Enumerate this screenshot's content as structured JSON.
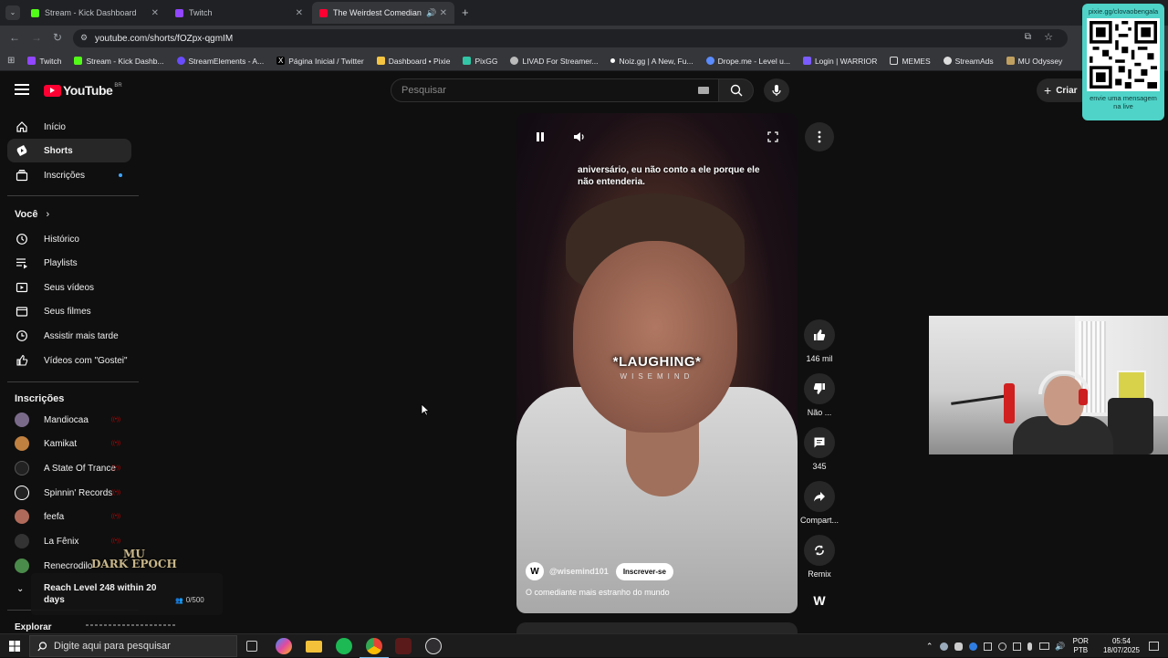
{
  "browser": {
    "tabs": [
      {
        "title": "Stream - Kick Dashboard",
        "color": "#53fc18"
      },
      {
        "title": "Twitch",
        "color": "#9146ff"
      },
      {
        "title": "The Weirdest Comedian in",
        "color": "#ff0033",
        "active": true
      }
    ],
    "url": "youtube.com/shorts/fOZpx-qgmIM",
    "bookmarks": [
      {
        "label": "Twitch",
        "color": "#9146ff"
      },
      {
        "label": "Stream - Kick Dashb...",
        "color": "#53fc18"
      },
      {
        "label": "StreamElements - A...",
        "color": "#6a4cff"
      },
      {
        "label": "Página Inicial / Twitter",
        "color": "#ffffff"
      },
      {
        "label": "Dashboard • Pixie",
        "color": "#f5c542"
      },
      {
        "label": "PixGG",
        "color": "#32c5a6"
      },
      {
        "label": "LIVAD For Streamer...",
        "color": "#bbbbbb"
      },
      {
        "label": "Noiz.gg | A New, Fu...",
        "color": "#ffffff"
      },
      {
        "label": "Drope.me - Level u...",
        "color": "#5b8cff"
      },
      {
        "label": "Login | WARRIOR",
        "color": "#7a5cff"
      },
      {
        "label": "MEMES",
        "color": "#dddddd"
      },
      {
        "label": "StreamAds",
        "color": "#dddddd"
      },
      {
        "label": "MU Odyssey",
        "color": "#c0a060"
      }
    ]
  },
  "youtube": {
    "logo": "YouTube",
    "region": "BR",
    "search_placeholder": "Pesquisar",
    "create_label": "Criar",
    "sidebar": {
      "main": [
        {
          "label": "Início",
          "icon": "home-icon"
        },
        {
          "label": "Shorts",
          "icon": "shorts-icon",
          "active": true
        },
        {
          "label": "Inscrições",
          "icon": "subscriptions-icon"
        }
      ],
      "you_heading": "Você",
      "you_items": [
        {
          "label": "Histórico",
          "icon": "history-icon"
        },
        {
          "label": "Playlists",
          "icon": "playlists-icon"
        },
        {
          "label": "Seus vídeos",
          "icon": "your-videos-icon"
        },
        {
          "label": "Seus filmes",
          "icon": "movies-icon"
        },
        {
          "label": "Assistir mais tarde",
          "icon": "watch-later-icon"
        },
        {
          "label": "Vídeos com \"Gostei\"",
          "icon": "liked-icon"
        }
      ],
      "subs_heading": "Inscrições",
      "subscriptions": [
        {
          "label": "Mandiocaa",
          "color": "#7a6a8a"
        },
        {
          "label": "Kamikat",
          "color": "#c08040"
        },
        {
          "label": "A State Of Trance",
          "color": "#222222"
        },
        {
          "label": "Spinnin' Records",
          "color": "#222222"
        },
        {
          "label": "feefa",
          "color": "#b06a5a"
        },
        {
          "label": "La Fênix",
          "color": "#333333"
        },
        {
          "label": "Renecrodilo",
          "color": "#4a8a4a"
        }
      ],
      "explore_heading": "Explorar"
    },
    "short": {
      "caption": "aniversário, eu não conto a ele porque ele não entenderia.",
      "overlay_text": "*LAUGHING*",
      "watermark": "WISEMIND",
      "channel": "@wisemind101",
      "channel_initial": "W",
      "subscribe_label": "Inscrever-se",
      "title": "O comediante mais estranho do mundo"
    },
    "actions": [
      {
        "label": "146 mil",
        "icon": "like-icon"
      },
      {
        "label": "Não ...",
        "icon": "dislike-icon"
      },
      {
        "label": "345",
        "icon": "comments-icon"
      },
      {
        "label": "Compart...",
        "icon": "share-icon"
      },
      {
        "label": "Remix",
        "icon": "remix-icon"
      }
    ],
    "channel_badge": "W"
  },
  "overlays": {
    "qr_top": "pixie.gg/clovaobengala",
    "qr_bottom": "envie uma mensagem na live",
    "game_logo_line1": "MU",
    "game_logo_line2": "DARK EPOCH",
    "achievement_text": "Reach Level 248 within 20 days",
    "achievement_progress": "0/500"
  },
  "taskbar": {
    "search_placeholder": "Digite aqui para pesquisar",
    "lang_line1": "POR",
    "lang_line2": "PTB",
    "time": "05:54",
    "date": "18/07/2025"
  }
}
